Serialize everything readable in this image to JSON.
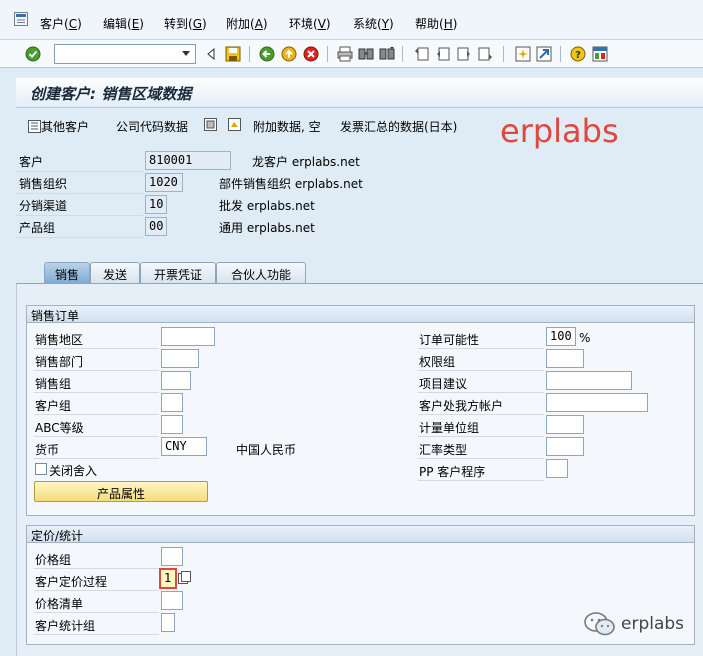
{
  "menu": {
    "items": [
      {
        "name": "customer",
        "label": "客户(",
        "key": "C",
        "suffix": ")"
      },
      {
        "name": "edit",
        "label": "编辑(",
        "key": "E",
        "suffix": ")"
      },
      {
        "name": "goto",
        "label": "转到(",
        "key": "G",
        "suffix": ")"
      },
      {
        "name": "extras",
        "label": "附加(",
        "key": "A",
        "suffix": ")"
      },
      {
        "name": "environment",
        "label": "环境(",
        "key": "V",
        "suffix": ")"
      },
      {
        "name": "system",
        "label": "系统(",
        "key": "Y",
        "suffix": ")"
      },
      {
        "name": "help",
        "label": "帮助(",
        "key": "H",
        "suffix": ")"
      }
    ]
  },
  "toolbar": {
    "command_value": ""
  },
  "title": "创建客户: 销售区域数据",
  "app_toolbar": {
    "other_customer": "其他客户",
    "company_code_data": "公司代码数据",
    "additional_data": "附加数据, 空",
    "sales_summary": "发票汇总的数据(日本)"
  },
  "watermark": "erplabs",
  "header": {
    "customer": {
      "label": "客户",
      "value": "810001",
      "desc": "龙客户 erplabs.net"
    },
    "sales_org": {
      "label": "销售组织",
      "value": "1020",
      "desc": "部件销售组织 erplabs.net"
    },
    "distr_channel": {
      "label": "分销渠道",
      "value": "10",
      "desc": "批发 erplabs.net"
    },
    "division": {
      "label": "产品组",
      "value": "00",
      "desc": "通用 erplabs.net"
    }
  },
  "tabs": [
    {
      "label": "销售",
      "active": true
    },
    {
      "label": "发送",
      "active": false
    },
    {
      "label": "开票凭证",
      "active": false
    },
    {
      "label": "合伙人功能",
      "active": false
    }
  ],
  "sales_order": {
    "title": "销售订单",
    "sales_district": {
      "label": "销售地区",
      "value": ""
    },
    "sales_office": {
      "label": "销售部门",
      "value": ""
    },
    "sales_group": {
      "label": "销售组",
      "value": ""
    },
    "customer_group": {
      "label": "客户组",
      "value": ""
    },
    "abc_class": {
      "label": "ABC等级",
      "value": ""
    },
    "currency": {
      "label": "货币",
      "value": "CNY",
      "desc": "中国人民币"
    },
    "rounding_off": {
      "label": "关闭舍入",
      "checked": false
    },
    "product_attributes_btn": "产品属性",
    "order_probability": {
      "label": "订单可能性",
      "value": "100",
      "unit": "%"
    },
    "authorization_group": {
      "label": "权限组",
      "value": ""
    },
    "item_proposal": {
      "label": "项目建议",
      "value": ""
    },
    "account_at_customer": {
      "label": "客户处我方帐户",
      "value": ""
    },
    "uom_group": {
      "label": "计量单位组",
      "value": ""
    },
    "exchange_rate_type": {
      "label": "汇率类型",
      "value": ""
    },
    "pp_customer_procedure": {
      "label": "PP 客户程序",
      "value": ""
    }
  },
  "pricing": {
    "title": "定价/统计",
    "price_group": {
      "label": "价格组",
      "value": ""
    },
    "cust_pricing_procedure": {
      "label": "客户定价过程",
      "value": "1"
    },
    "price_list": {
      "label": "价格清单",
      "value": ""
    },
    "cust_stats_group": {
      "label": "客户统计组",
      "value": ""
    }
  },
  "wechat_text": "erplabs"
}
